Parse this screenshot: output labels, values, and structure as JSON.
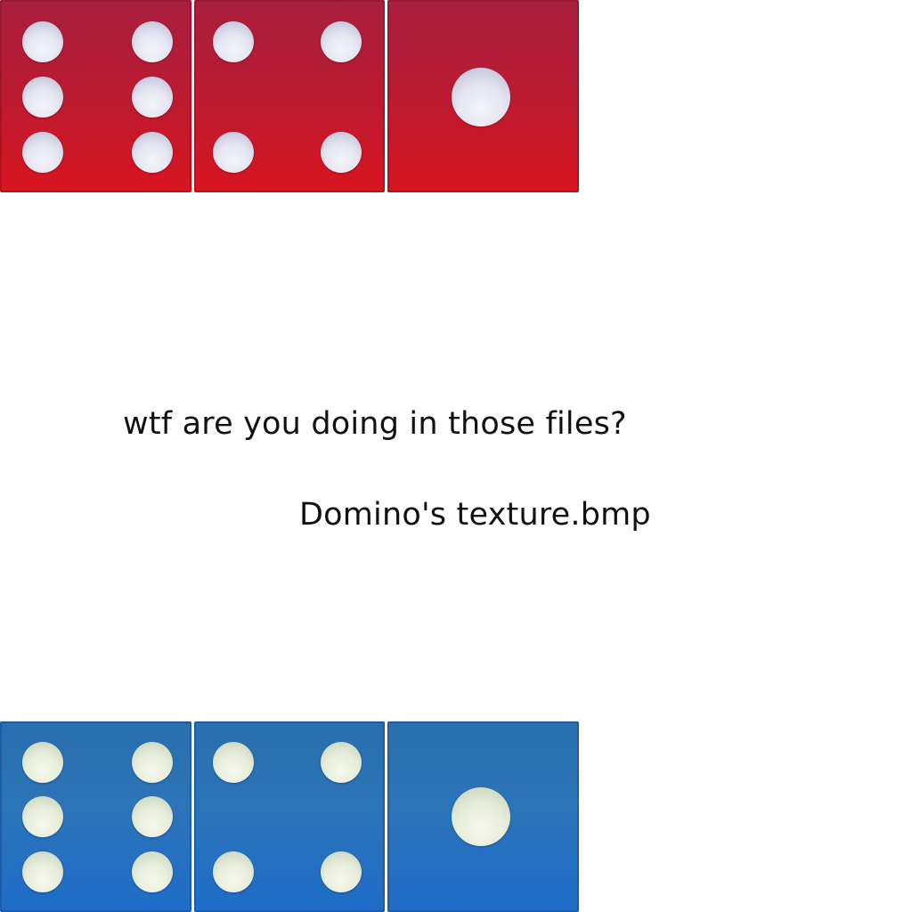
{
  "texture": {
    "top_row": {
      "color": "#b81b32",
      "faces": [
        {
          "value": 6
        },
        {
          "value": 4
        },
        {
          "value": 1
        }
      ]
    },
    "bottom_row": {
      "color": "#2b74b8",
      "faces": [
        {
          "value": 6
        },
        {
          "value": 4
        },
        {
          "value": 1
        }
      ]
    }
  },
  "message": {
    "question": "wtf are you doing in those files?",
    "signature": "Domino's texture.bmp"
  }
}
